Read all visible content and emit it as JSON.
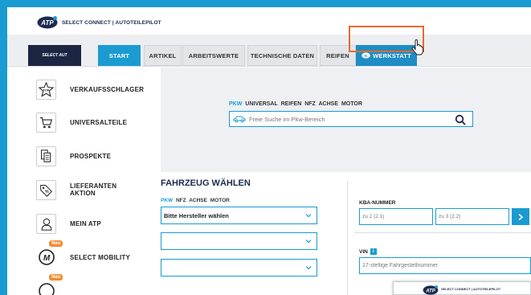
{
  "brand": {
    "text": "SELECT CONNECT | AUTOTEILEPILOT",
    "logo_text": "ATP",
    "sc_logo_text": "SELECT AUT"
  },
  "nav": {
    "items": [
      {
        "label": "START"
      },
      {
        "label": "ARTIKEL"
      },
      {
        "label": "ARBEITSWERTE"
      },
      {
        "label": "TECHNISCHE DATEN"
      },
      {
        "label": "REIFEN"
      },
      {
        "label": "WERKSTATT"
      }
    ]
  },
  "sidebar": {
    "items": [
      {
        "label": "VERKAUFSSCHLAGER",
        "icon": "top-star-icon"
      },
      {
        "label": "UNIVERSALTEILE",
        "icon": "cart-icon"
      },
      {
        "label": "PROSPEKTE",
        "icon": "brochure-icon"
      },
      {
        "label": "LIEFERANTEN AKTION",
        "icon": "tag-icon"
      },
      {
        "label": "MEIN ATP",
        "icon": "user-icon"
      },
      {
        "label": "SELECT MOBILITY",
        "icon": "mobility-icon",
        "badge": "Neu"
      },
      {
        "label": "",
        "icon": "mobility-icon",
        "badge": "Neu"
      }
    ]
  },
  "search": {
    "tabs": [
      "PKW",
      "UNIVERSAL",
      "REIFEN",
      "NFZ",
      "ACHSE",
      "MOTOR"
    ],
    "placeholder": "Freie Suche im Pkw-Bereich"
  },
  "fahrzeug": {
    "title": "FAHRZEUG WÄHLEN",
    "tabs": [
      "PKW",
      "NFZ",
      "ACHSE",
      "MOTOR"
    ],
    "manufacturer_placeholder": "Bitte Hersteller wählen",
    "kba_label": "KBA-NUMMER",
    "kba_field1": "zu 2 (2.1)",
    "kba_field2": "zu 3 (2.2)",
    "vin_label": "VIN",
    "vin_info": "i",
    "vin_placeholder": "17-stellige Fahrgestellnummer"
  },
  "inset": {
    "text": "SELECT CONNECT | AUTOTEILEPILOT"
  },
  "colors": {
    "accent": "#1a9bd1",
    "highlight": "#e96a2f",
    "navy": "#1d2a50"
  }
}
